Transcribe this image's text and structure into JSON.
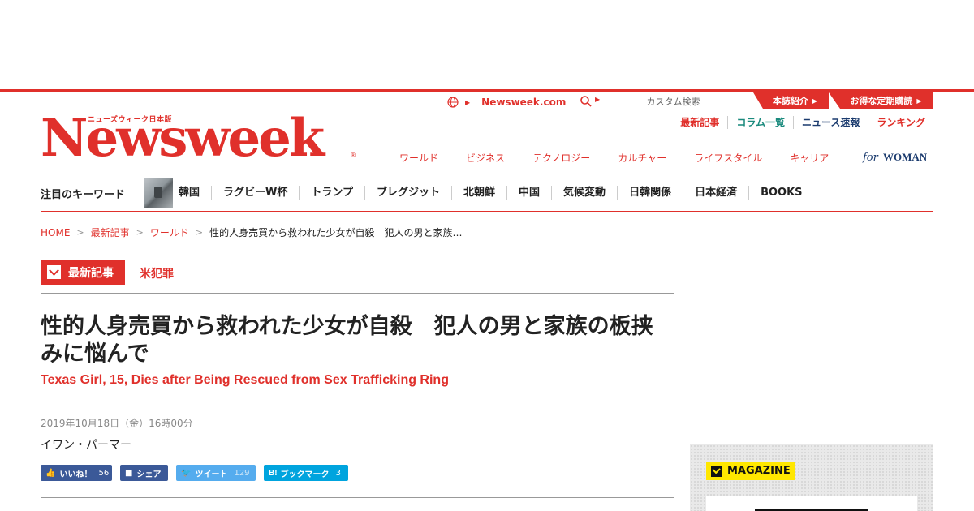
{
  "header": {
    "logo_sub": "ニューズウィーク日本版",
    "logo_main": "Newsweek",
    "logo_reg": "®",
    "site_link": "Newsweek.com",
    "search_placeholder": "カスタム検索",
    "tab_about": "本誌紹介",
    "tab_subscribe": "お得な定期購読",
    "sublinks": [
      "最新記事",
      "コラム一覧",
      "ニュース速報",
      "ランキング"
    ],
    "categories": [
      "ワールド",
      "ビジネス",
      "テクノロジー",
      "カルチャー",
      "ライフスタイル",
      "キャリア"
    ],
    "for_woman_for": "for",
    "for_woman_word": "WOMAN"
  },
  "keywords": {
    "title": "注目のキーワード",
    "items": [
      "韓国",
      "ラグビーW杯",
      "トランプ",
      "ブレグジット",
      "北朝鮮",
      "中国",
      "気候変動",
      "日韓関係",
      "日本経済",
      "BOOKS"
    ]
  },
  "breadcrumb": {
    "items": [
      "HOME",
      "最新記事",
      "ワールド"
    ],
    "current": "性的人身売買から救われた少女が自殺　犯人の男と家族…"
  },
  "article": {
    "category": "最新記事",
    "tag": "米犯罪",
    "headline": "性的人身売買から救われた少女が自殺　犯人の男と家族の板挟みに悩んで",
    "subtitle": "Texas Girl, 15, Dies after Being Rescued from Sex Trafficking Ring",
    "date": "2019年10月18日（金）16時00分",
    "author": "イワン・パーマー"
  },
  "share": {
    "like_label": "いいね！",
    "like_count": "56",
    "facebook_label": "シェア",
    "tweet_label": "ツイート",
    "tweet_count": "129",
    "hatena_icon": "B!",
    "bookmark_label": "ブックマーク",
    "bookmark_count": "3"
  },
  "sidebar": {
    "magazine_label": "MAGAZINE"
  },
  "colors": {
    "brand_red": "#e0302b",
    "facebook": "#3b5998",
    "twitter": "#55acee",
    "hatena": "#00a4de",
    "magazine_yellow": "#ffe700"
  },
  "icons": [
    "globe-icon",
    "search-icon",
    "check-icon",
    "thumbs-up-icon",
    "facebook-icon",
    "twitter-icon",
    "hatena-icon"
  ]
}
